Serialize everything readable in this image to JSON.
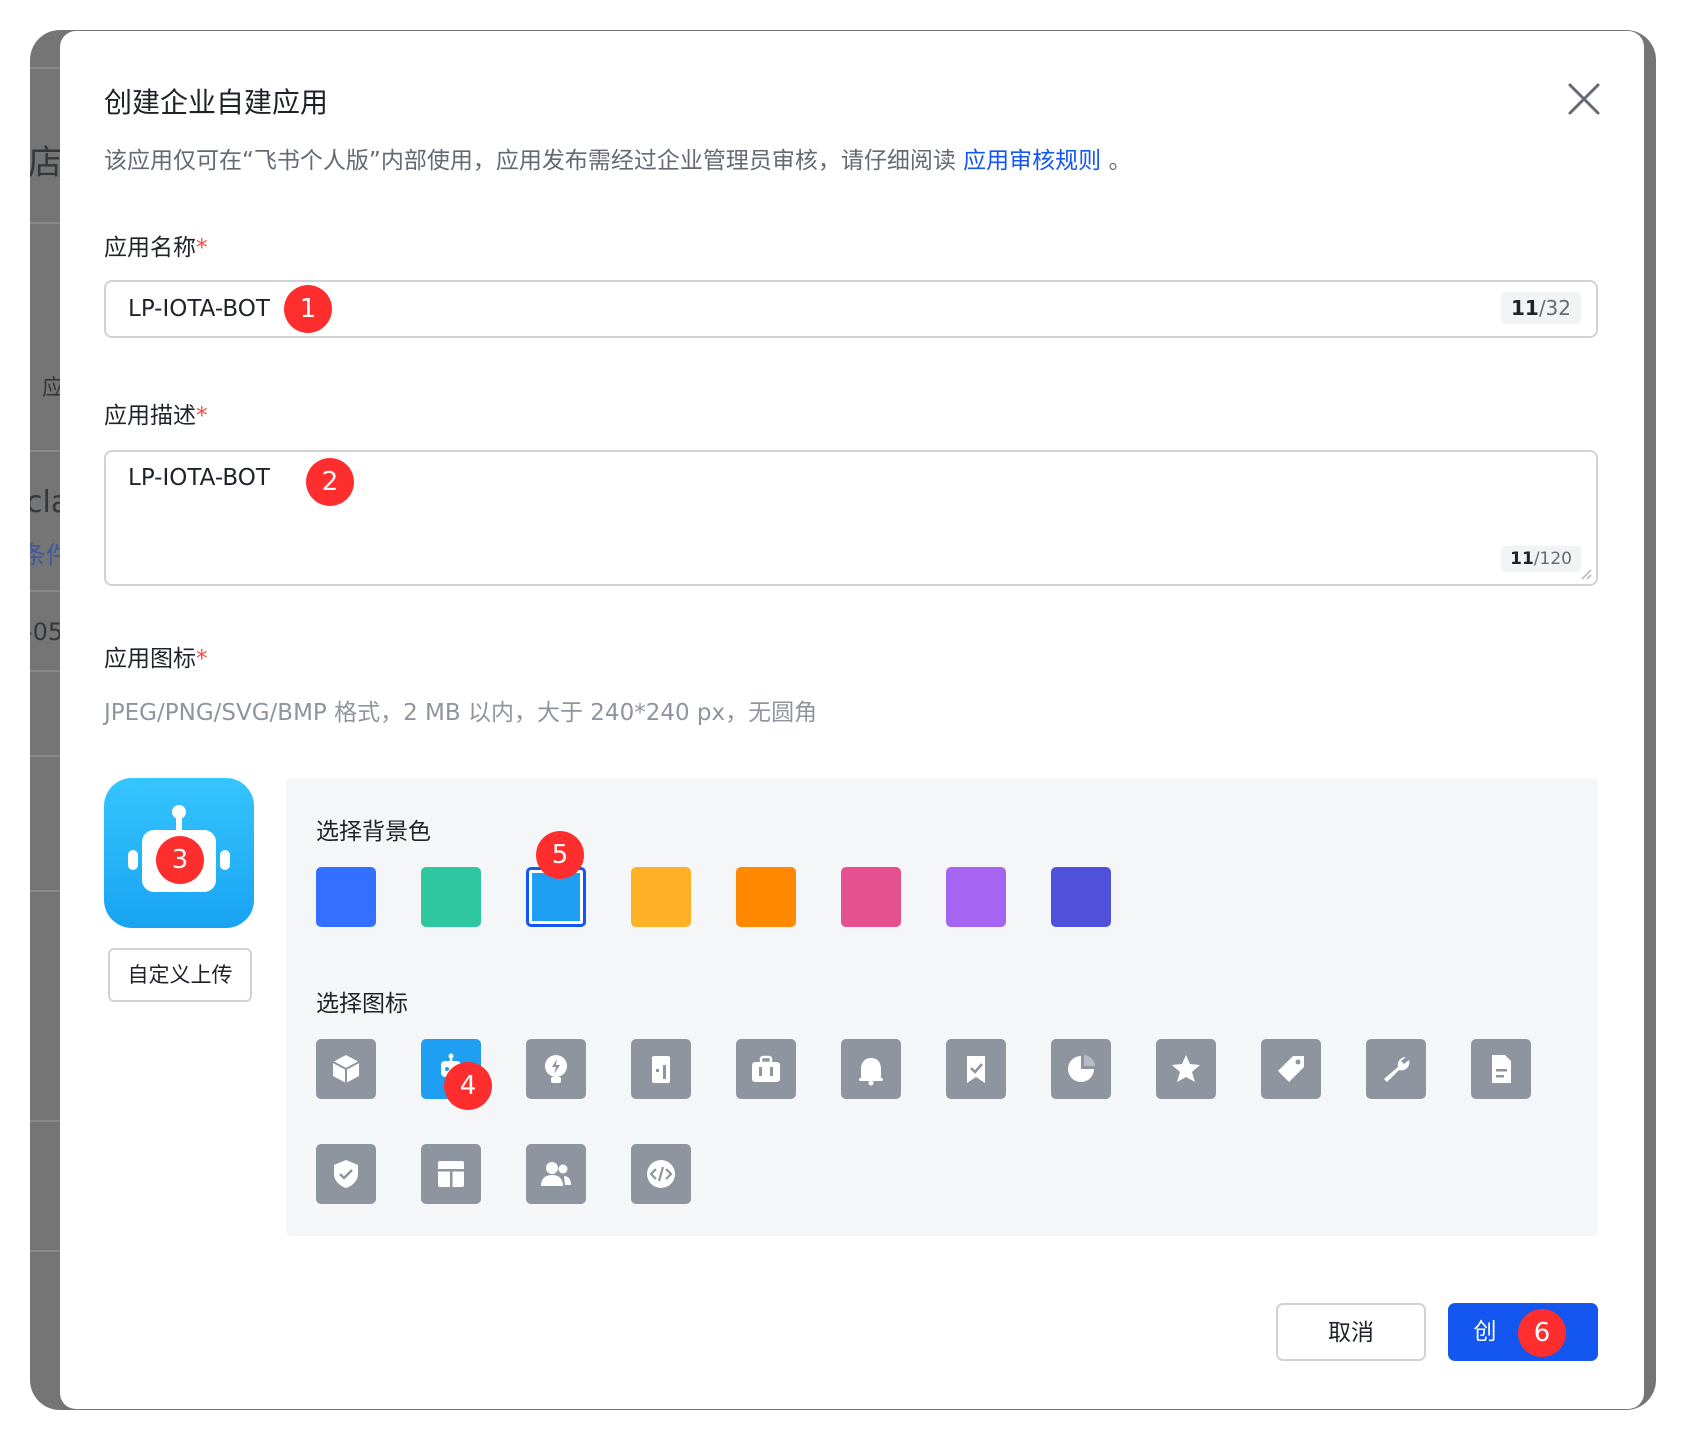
{
  "dialog": {
    "title": "创建企业自建应用",
    "subtitle_text": "该应用仅可在“飞书个人版”内部使用，应用发布需经过企业管理员审核，请仔细阅读",
    "subtitle_link": "应用审核规则",
    "subtitle_end": "。"
  },
  "form": {
    "name_label": "应用名称",
    "required_mark": "*",
    "name_value": "LP-IOTA-BOT",
    "name_count": "11",
    "name_max": "/32",
    "desc_label": "应用描述",
    "desc_value": "LP-IOTA-BOT",
    "desc_count": "11",
    "desc_max": "/120",
    "icon_label": "应用图标",
    "icon_hint": "JPEG/PNG/SVG/BMP 格式，2 MB 以内，大于 240*240 px，无圆角",
    "upload_label": "自定义上传",
    "bg_section_label": "选择背景色",
    "icon_section_label": "选择图标"
  },
  "colors": {
    "swatches": [
      "#3370ff",
      "#2ec7a0",
      "#1e9ff2",
      "#ffb125",
      "#ff8800",
      "#e5518f",
      "#a565f2",
      "#5051db"
    ],
    "selected_index": 2,
    "link": "#1456f0",
    "primary": "#1456f0"
  },
  "icons": {
    "row1": [
      "cube-icon",
      "robot-icon",
      "lightbulb-icon",
      "building-icon",
      "briefcase-icon",
      "bell-icon",
      "bookmark-check-icon",
      "pie-chart-icon",
      "star-icon",
      "tag-icon",
      "wrench-icon",
      "document-icon"
    ],
    "row2": [
      "shield-check-icon",
      "layout-icon",
      "users-icon",
      "code-icon"
    ],
    "selected": "robot-icon"
  },
  "buttons": {
    "cancel": "取消",
    "create_partial": "创"
  },
  "markers": [
    "1",
    "2",
    "3",
    "4",
    "5",
    "6"
  ],
  "background_fragments": {
    "frag1": "店",
    "frag2": "应",
    "frag3": "cla",
    "frag4": "条件",
    "frag5": "-05"
  }
}
